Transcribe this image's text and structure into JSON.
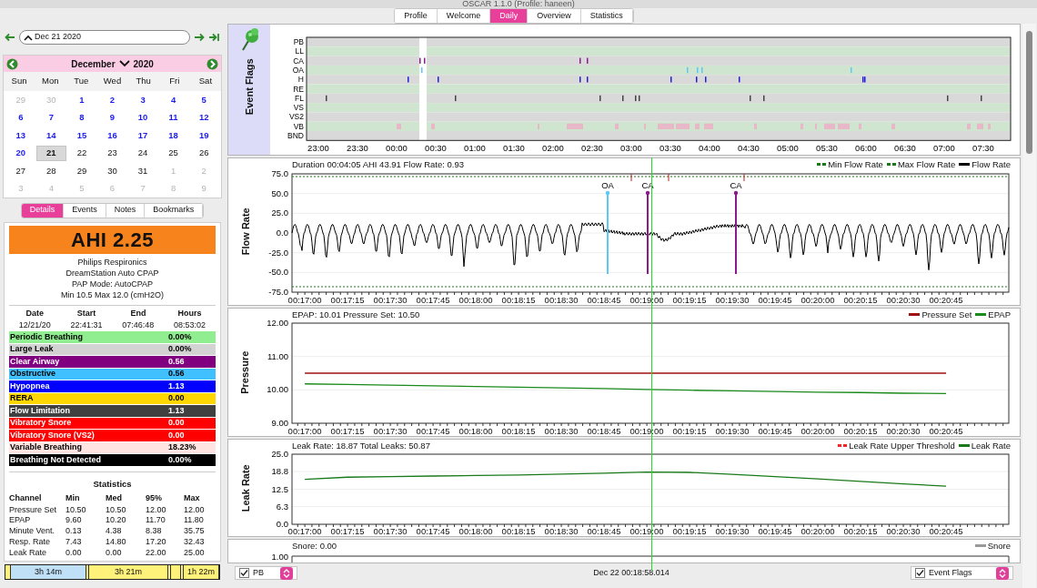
{
  "window": {
    "title": "OSCAR 1.1.0 (Profile: haneen)"
  },
  "tabs": [
    {
      "label": "Profile",
      "selected": false
    },
    {
      "label": "Welcome",
      "selected": false
    },
    {
      "label": "Daily",
      "selected": true
    },
    {
      "label": "Overview",
      "selected": false
    },
    {
      "label": "Statistics",
      "selected": false
    }
  ],
  "date_nav": {
    "value": "Dec 21 2020"
  },
  "calendar": {
    "month": "December",
    "year": "2020",
    "weekdays": [
      "Sun",
      "Mon",
      "Tue",
      "Wed",
      "Thu",
      "Fri",
      "Sat"
    ],
    "days": [
      {
        "day": "29",
        "kind": "other",
        "selected": false
      },
      {
        "day": "30",
        "kind": "other",
        "selected": false
      },
      {
        "day": "1",
        "kind": "data",
        "selected": false
      },
      {
        "day": "2",
        "kind": "data",
        "selected": false
      },
      {
        "day": "3",
        "kind": "data",
        "selected": false
      },
      {
        "day": "4",
        "kind": "data",
        "selected": false
      },
      {
        "day": "5",
        "kind": "data",
        "selected": false
      },
      {
        "day": "6",
        "kind": "data",
        "selected": false
      },
      {
        "day": "7",
        "kind": "data",
        "selected": false
      },
      {
        "day": "8",
        "kind": "data",
        "selected": false
      },
      {
        "day": "9",
        "kind": "data",
        "selected": false
      },
      {
        "day": "10",
        "kind": "data",
        "selected": false
      },
      {
        "day": "11",
        "kind": "data",
        "selected": false
      },
      {
        "day": "12",
        "kind": "data",
        "selected": false
      },
      {
        "day": "13",
        "kind": "data",
        "selected": false
      },
      {
        "day": "14",
        "kind": "data",
        "selected": false
      },
      {
        "day": "15",
        "kind": "data",
        "selected": false
      },
      {
        "day": "16",
        "kind": "data",
        "selected": false
      },
      {
        "day": "17",
        "kind": "data",
        "selected": false
      },
      {
        "day": "18",
        "kind": "data",
        "selected": false
      },
      {
        "day": "19",
        "kind": "data",
        "selected": false
      },
      {
        "day": "20",
        "kind": "data",
        "selected": false
      },
      {
        "day": "21",
        "kind": "plain",
        "selected": true
      },
      {
        "day": "22",
        "kind": "plain",
        "selected": false
      },
      {
        "day": "23",
        "kind": "plain",
        "selected": false
      },
      {
        "day": "24",
        "kind": "plain",
        "selected": false
      },
      {
        "day": "25",
        "kind": "plain",
        "selected": false
      },
      {
        "day": "26",
        "kind": "plain",
        "selected": false
      },
      {
        "day": "27",
        "kind": "plain",
        "selected": false
      },
      {
        "day": "28",
        "kind": "plain",
        "selected": false
      },
      {
        "day": "29",
        "kind": "plain",
        "selected": false
      },
      {
        "day": "30",
        "kind": "plain",
        "selected": false
      },
      {
        "day": "31",
        "kind": "plain",
        "selected": false
      },
      {
        "day": "1",
        "kind": "other",
        "selected": false
      },
      {
        "day": "2",
        "kind": "other",
        "selected": false
      },
      {
        "day": "3",
        "kind": "other",
        "selected": false
      },
      {
        "day": "4",
        "kind": "other",
        "selected": false
      },
      {
        "day": "5",
        "kind": "other",
        "selected": false
      },
      {
        "day": "6",
        "kind": "other",
        "selected": false
      },
      {
        "day": "7",
        "kind": "other",
        "selected": false
      },
      {
        "day": "8",
        "kind": "other",
        "selected": false
      },
      {
        "day": "9",
        "kind": "other",
        "selected": false
      }
    ]
  },
  "panel_tabs": [
    {
      "label": "Details",
      "selected": true
    },
    {
      "label": "Events",
      "selected": false
    },
    {
      "label": "Notes",
      "selected": false
    },
    {
      "label": "Bookmarks",
      "selected": false
    }
  ],
  "details": {
    "ahi": "AHI 2.25",
    "device": [
      "Philips Respironics",
      "DreamStation Auto CPAP",
      "PAP Mode: AutoCPAP",
      "Min 10.5 Max 12.0 (cmH2O)"
    ],
    "session_headers": [
      "Date",
      "Start",
      "End",
      "Hours"
    ],
    "session_values": [
      "12/21/20",
      "22:41:31",
      "07:46:48",
      "08:53:02"
    ],
    "events": [
      {
        "name": "Periodic Breathing",
        "value": "0.00%",
        "color": "#90ee90"
      },
      {
        "name": "Large Leak",
        "value": "0.00%",
        "color": "#d3d3d3"
      },
      {
        "name": "Clear Airway",
        "value": "0.56",
        "color": "#800080"
      },
      {
        "name": "Obstructive",
        "value": "0.56",
        "color": "#40c0ff"
      },
      {
        "name": "Hypopnea",
        "value": "1.13",
        "color": "#0000ff"
      },
      {
        "name": "RERA",
        "value": "0.00",
        "color": "#ffd700"
      },
      {
        "name": "Flow Limitation",
        "value": "1.13",
        "color": "#404040"
      },
      {
        "name": "Vibratory Snore",
        "value": "0.00",
        "color": "#ff0000"
      },
      {
        "name": "Vibratory Snore (VS2)",
        "value": "0.00",
        "color": "#ff0000"
      },
      {
        "name": "Variable Breathing",
        "value": "18.23%",
        "color": "#ffe4e1"
      },
      {
        "name": "Breathing Not Detected",
        "value": "0.00%",
        "color": "#000000"
      }
    ],
    "statistics": {
      "title": "Statistics",
      "columns": [
        "Channel",
        "Min",
        "Med",
        "95%",
        "Max"
      ],
      "rows": [
        [
          "Pressure Set",
          "10.50",
          "10.50",
          "12.00",
          "12.00"
        ],
        [
          "EPAP",
          "9.60",
          "10.20",
          "11.70",
          "11.80"
        ],
        [
          "Minute Vent.",
          "0.13",
          "4.38",
          "8.38",
          "35.75"
        ],
        [
          "Resp. Rate",
          "7.43",
          "14.80",
          "17.20",
          "32.43"
        ],
        [
          "Leak Rate",
          "0.00",
          "0.00",
          "22.00",
          "25.00"
        ]
      ]
    }
  },
  "usage_bar": [
    {
      "label": "3h 14m",
      "color": "#bfe0f7"
    },
    {
      "label": "3h 21m",
      "color": "#fff27a"
    },
    {
      "color": "#fff27a"
    },
    {
      "label": "1h 22m",
      "color": "#fff27a"
    }
  ],
  "event_flags": {
    "title": "Event Flags",
    "rows": [
      "PB",
      "LL",
      "CA",
      "OA",
      "H",
      "RE",
      "FL",
      "VS",
      "VS2",
      "VB",
      "BND"
    ],
    "x_ticks": [
      "23:00",
      "23:30",
      "00:00",
      "00:30",
      "01:00",
      "01:30",
      "02:00",
      "02:30",
      "03:00",
      "03:30",
      "04:00",
      "04:30",
      "05:00",
      "05:30",
      "06:00",
      "06:30",
      "07:00",
      "07:30"
    ]
  },
  "flow_rate": {
    "title": "Flow Rate",
    "info": "Duration 00:04:05 AHI 43.91 Flow Rate: 0.93",
    "x_ticks": [
      "00:17:00",
      "00:17:15",
      "00:17:30",
      "00:17:45",
      "00:18:00",
      "00:18:15",
      "00:18:30",
      "00:18:45",
      "00:19:00",
      "00:19:15",
      "00:19:30",
      "00:19:45",
      "00:20:00",
      "00:20:15",
      "00:20:30",
      "00:20:45"
    ],
    "legend": [
      {
        "label": "Min Flow Rate",
        "color": "#1a7a1a",
        "kind": "dashed"
      },
      {
        "label": "Max Flow Rate",
        "color": "#1a7a1a",
        "kind": "dashed"
      },
      {
        "label": "Flow Rate",
        "color": "#000000",
        "kind": "solid"
      }
    ],
    "y_ticks": [
      "75.0",
      "50.0",
      "25.0",
      "0.0",
      "-25.0",
      "-50.0",
      "-75.0"
    ],
    "markers": [
      {
        "label": "OA",
        "color": "#5bc8f5"
      },
      {
        "label": "CA",
        "color": "#8b1a8b"
      },
      {
        "label": "CA",
        "color": "#8b1a8b"
      }
    ]
  },
  "pressure": {
    "title": "Pressure",
    "info": "EPAP: 10.01 Pressure Set: 10.50",
    "chart_data": {
      "type": "line",
      "categories": [
        "00:17:00",
        "00:17:15",
        "00:17:30",
        "00:17:45",
        "00:18:00",
        "00:18:15",
        "00:18:30",
        "00:18:45",
        "00:19:00",
        "00:19:15",
        "00:19:30",
        "00:19:45",
        "00:20:00",
        "00:20:15",
        "00:20:30",
        "00:20:45"
      ],
      "ylim": [
        9,
        12
      ],
      "grid": true,
      "yticks": [
        {
          "value": 9,
          "label": "9.00"
        },
        {
          "value": 10,
          "label": "10.00"
        },
        {
          "value": 11,
          "label": "11.00"
        },
        {
          "value": 12,
          "label": "12.00"
        }
      ],
      "series": [
        {
          "name": "Pressure Set",
          "color": "#a01010",
          "values": [
            10.5,
            10.5,
            10.5,
            10.5,
            10.5,
            10.5,
            10.5,
            10.5,
            10.5,
            10.5,
            10.5,
            10.5,
            10.5,
            10.5,
            10.5,
            10.5
          ]
        },
        {
          "name": "EPAP",
          "color": "#1a8a1a",
          "values": [
            10.18,
            10.16,
            10.14,
            10.12,
            10.1,
            10.08,
            10.06,
            10.04,
            10.01,
            9.99,
            9.97,
            9.95,
            9.93,
            9.92,
            9.9,
            9.89
          ]
        }
      ]
    }
  },
  "leak_rate": {
    "title": "Leak Rate",
    "info": "Leak Rate: 18.87 Total Leaks: 50.87",
    "threshold_legend": {
      "label": "Leak Rate Upper Threshold",
      "color": "#ff2020"
    },
    "chart_data": {
      "type": "line",
      "categories": [
        "00:17:00",
        "00:17:15",
        "00:17:30",
        "00:17:45",
        "00:18:00",
        "00:18:15",
        "00:18:30",
        "00:18:45",
        "00:19:00",
        "00:19:15",
        "00:19:30",
        "00:19:45",
        "00:20:00",
        "00:20:15",
        "00:20:30",
        "00:20:45"
      ],
      "ylim": [
        0,
        25
      ],
      "grid": true,
      "yticks": [
        {
          "value": 0,
          "label": "0.0"
        },
        {
          "value": 6.3,
          "label": "6.3"
        },
        {
          "value": 12.5,
          "label": "12.5"
        },
        {
          "value": 18.8,
          "label": "18.8"
        },
        {
          "value": 25,
          "label": "25.0"
        }
      ],
      "series": [
        {
          "name": "Leak Rate",
          "color": "#1a7a1a",
          "values": [
            16.0,
            16.8,
            17.0,
            17.2,
            17.4,
            17.6,
            17.9,
            18.2,
            18.6,
            18.5,
            17.8,
            17.0,
            16.2,
            15.3,
            14.4,
            13.6
          ]
        }
      ]
    }
  },
  "snore": {
    "info": "Snore: 0.00",
    "legend": {
      "label": "Snore",
      "color": "#999999"
    },
    "y_ticks": [
      "1.00"
    ]
  },
  "status_bar": {
    "left": {
      "label": "PB",
      "checked": true
    },
    "timestamp": "Dec 22 00:18:58.014",
    "right": {
      "label": "Event Flags",
      "checked": true
    }
  }
}
